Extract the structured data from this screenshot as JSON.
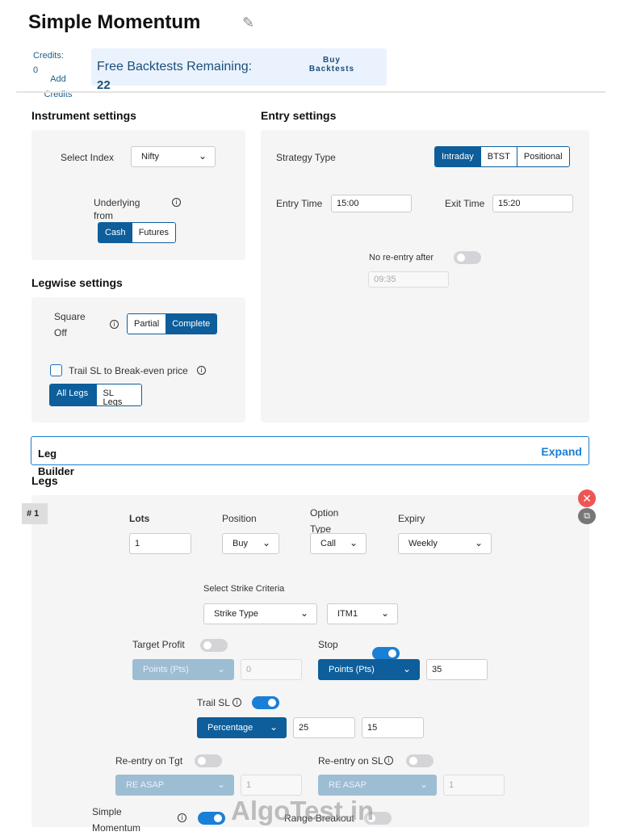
{
  "header": {
    "title": "Simple Momentum",
    "credits_label": "Credits:",
    "credits_value": "0",
    "add_credits": "Add Credits",
    "free_label": "Free Backtests Remaining:",
    "free_value": "22",
    "buy_label": "Buy Backtests"
  },
  "instrument": {
    "title": "Instrument settings",
    "select_index_label": "Select Index",
    "select_index_value": "Nifty",
    "underlying_label": "Underlying from",
    "options": [
      "Cash",
      "Futures"
    ]
  },
  "entry": {
    "title": "Entry settings",
    "strategy_type_label": "Strategy Type",
    "strategy_types": [
      "Intraday",
      "BTST",
      "Positional"
    ],
    "entry_time_label": "Entry Time",
    "entry_time": "15:00",
    "exit_time_label": "Exit Time",
    "exit_time": "15:20",
    "no_reentry_label": "No re-entry after",
    "no_reentry_time": "09:35"
  },
  "legwise": {
    "title": "Legwise settings",
    "square_off_label": "Square Off",
    "square_off_options": [
      "Partial",
      "Complete"
    ],
    "trail_label": "Trail SL to Break-even price",
    "trail_options": [
      "All Legs",
      "SL Legs"
    ]
  },
  "leg_builder": {
    "title": "Leg Builder",
    "expand": "Expand"
  },
  "legs": {
    "title": "Legs",
    "leg_number": "# 1",
    "lots_label": "Lots",
    "lots": "1",
    "position_label": "Position",
    "position": "Buy",
    "option_type_label": "Option Type",
    "option_type": "Call",
    "expiry_label": "Expiry",
    "expiry": "Weekly",
    "strike_criteria_label": "Select Strike Criteria",
    "strike_type": "Strike Type",
    "strike": "ITM1",
    "target_profit_label": "Target Profit",
    "tp_type": "Points (Pts)",
    "tp_value": "0",
    "stop_loss_label": "Stop Loss",
    "sl_type": "Points (Pts)",
    "sl_value": "35",
    "trail_sl_label": "Trail SL",
    "trail_type": "Percentage",
    "trail_x": "25",
    "trail_y": "15",
    "reentry_tgt_label": "Re-entry on Tgt",
    "reentry_tgt_type": "RE ASAP",
    "reentry_tgt_value": "1",
    "reentry_sl_label": "Re-entry on SL",
    "reentry_sl_type": "RE ASAP",
    "reentry_sl_value": "1",
    "simple_momentum_label": "Simple Momentum",
    "range_breakout_label": "Range Breakout"
  },
  "watermark": "AlgoTest.in"
}
